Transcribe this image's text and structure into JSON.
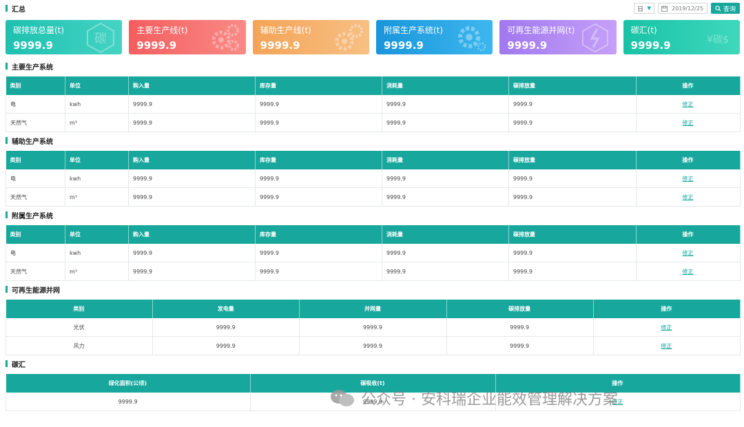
{
  "summary": {
    "title": "汇总"
  },
  "toolbar": {
    "select_value": "日",
    "date_value": "2019/12/25",
    "query_label": "查询"
  },
  "cards": [
    {
      "title": "碳排放总量(t)",
      "value": "9999.9",
      "deco": "carbon-icon",
      "deco_text": "碳"
    },
    {
      "title": "主要生产线(t)",
      "value": "9999.9",
      "deco": "gears-icon",
      "deco_text": ""
    },
    {
      "title": "辅助生产线(t)",
      "value": "9999.9",
      "deco": "gears-icon",
      "deco_text": ""
    },
    {
      "title": "附属生产系统(t)",
      "value": "9999.9",
      "deco": "gear-icon",
      "deco_text": ""
    },
    {
      "title": "可再生能源并网(t)",
      "value": "9999.9",
      "deco": "energy-icon",
      "deco_text": ""
    },
    {
      "title": "碳汇(t)",
      "value": "9999.9",
      "deco": "carbon-money-icon",
      "deco_text": "¥碳$"
    }
  ],
  "headers6": [
    "类别",
    "单位",
    "购入量",
    "库存量",
    "消耗量",
    "碳排放量",
    "操作"
  ],
  "main_system": {
    "title": "主要生产系统",
    "rows": [
      [
        "电",
        "kwh",
        "9999.9",
        "9999.9",
        "9999.9",
        "9999.9",
        "修正"
      ],
      [
        "天然气",
        "m³",
        "9999.9",
        "9999.9",
        "9999.9",
        "9999.9",
        "修正"
      ]
    ]
  },
  "aux_system": {
    "title": "辅助生产系统",
    "rows": [
      [
        "电",
        "kwh",
        "9999.9",
        "9999.9",
        "9999.9",
        "9999.9",
        "修正"
      ],
      [
        "天然气",
        "m³",
        "9999.9",
        "9999.9",
        "9999.9",
        "9999.9",
        "修正"
      ]
    ]
  },
  "attached_system": {
    "title": "附属生产系统",
    "rows": [
      [
        "电",
        "kwh",
        "9999.9",
        "9999.9",
        "9999.9",
        "9999.9",
        "修正"
      ],
      [
        "天然气",
        "m³",
        "9999.9",
        "9999.9",
        "9999.9",
        "9999.9",
        "修正"
      ]
    ]
  },
  "renewable": {
    "title": "可再生能源并网",
    "headers": [
      "类别",
      "发电量",
      "并网量",
      "碳排放量",
      "操作"
    ],
    "rows": [
      [
        "光伏",
        "9999.9",
        "9999.9",
        "9999.9",
        "修正"
      ],
      [
        "风力",
        "9999.9",
        "9999.9",
        "9999.9",
        "修正"
      ]
    ]
  },
  "sink": {
    "title": "碳汇",
    "headers": [
      "绿化面积(公顷)",
      "碳吸收(t)",
      "操作"
    ],
    "rows": [
      [
        "9999.9",
        "9999.9",
        "修正"
      ]
    ]
  },
  "watermark": {
    "text": "公众号 · 安科瑞企业能效管理解决方案"
  }
}
